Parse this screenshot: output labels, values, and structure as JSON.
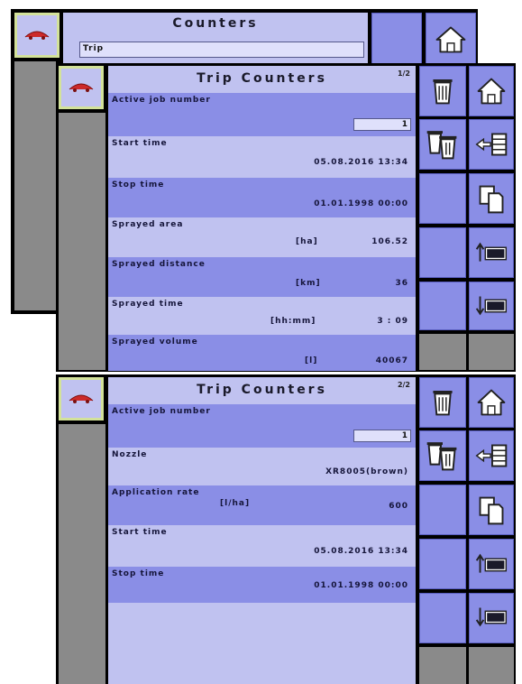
{
  "counters_screen": {
    "title": "Counters",
    "selected_value": "Trip"
  },
  "trip_page1": {
    "title": "Trip Counters",
    "page": "1/2",
    "active_job_label": "Active job number",
    "active_job_value": "1",
    "start_time_label": "Start time",
    "start_time_value": "05.08.2016 13:34",
    "stop_time_label": "Stop time",
    "stop_time_value": "01.01.1998 00:00",
    "sprayed_area_label": "Sprayed area",
    "sprayed_area_unit": "[ha]",
    "sprayed_area_value": "106.52",
    "sprayed_distance_label": "Sprayed distance",
    "sprayed_distance_unit": "[km]",
    "sprayed_distance_value": "36",
    "sprayed_time_label": "Sprayed time",
    "sprayed_time_unit": "[hh:mm]",
    "sprayed_time_value": "3 : 09",
    "sprayed_volume_label": "Sprayed volume",
    "sprayed_volume_unit": "[l]",
    "sprayed_volume_value": "40067"
  },
  "trip_page2": {
    "title": "Trip Counters",
    "page": "2/2",
    "active_job_label": "Active job number",
    "active_job_value": "1",
    "nozzle_label": "Nozzle",
    "nozzle_value": "XR8005(brown)",
    "application_rate_label": "Application rate",
    "application_rate_unit": "[l/ha]",
    "application_rate_value": "600",
    "start_time_label": "Start time",
    "start_time_value": "05.08.2016 13:34",
    "stop_time_label": "Stop time",
    "stop_time_value": "01.01.1998 00:00"
  },
  "icons": {
    "logo": "sprayer-logo-icon",
    "home": "home-icon",
    "trash": "trash-icon",
    "trash_all": "trash-all-icon",
    "back_list": "back-list-icon",
    "copy": "copy-icon",
    "counter_up": "counter-up-icon",
    "counter_down": "counter-down-icon"
  },
  "colors": {
    "header_light": "#c0c2f0",
    "row_dark": "#8a8ee6",
    "logo_border": "#d3e29a",
    "logo_red": "#cc2a2a"
  }
}
